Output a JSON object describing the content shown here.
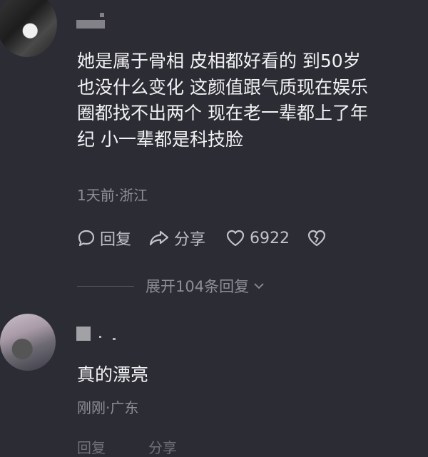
{
  "comments": [
    {
      "text_lines": [
        "她是属于骨相 皮相都好看的 到50岁",
        "也没什么变化 这颜值跟气质现在娱乐",
        "圈都找不出两个 现在老一辈都上了年",
        "纪 小一辈都是科技脸"
      ],
      "meta": "1天前·浙江",
      "reply_label": "回复",
      "share_label": "分享",
      "like_count": "6922",
      "expand_replies": "展开104条回复"
    },
    {
      "text": "真的漂亮",
      "meta": "刚刚·广东",
      "reply_label": "回复",
      "share_label": "分享"
    }
  ],
  "colors": {
    "background": "#2b2c34",
    "text": "#f2f2f4",
    "meta": "#8d8e96"
  }
}
